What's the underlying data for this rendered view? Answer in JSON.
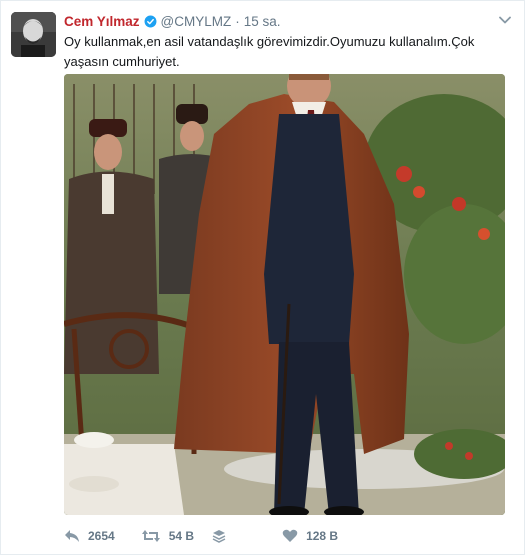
{
  "tweet": {
    "display_name": "Cem Yılmaz",
    "handle": "@CMYLMZ",
    "separator": "·",
    "time": "15 sa.",
    "text": "Oy kullanmak,en asil vatandaşlık görevimizdir.Oyumuzu kullanalım.Çok yaşasın cumhuriyet.",
    "verified": true
  },
  "actions": {
    "reply_count": "2654",
    "retweet_count": "54 B",
    "like_count": "128 B"
  },
  "colors": {
    "display_name": "#c1272d",
    "verified": "#1da1f2",
    "muted": "#657786",
    "border": "#e6ecf0"
  },
  "icons": {
    "caret": "chevron-down-icon",
    "reply": "reply-icon",
    "retweet": "retweet-icon",
    "layers": "layers-icon",
    "like": "heart-icon"
  }
}
